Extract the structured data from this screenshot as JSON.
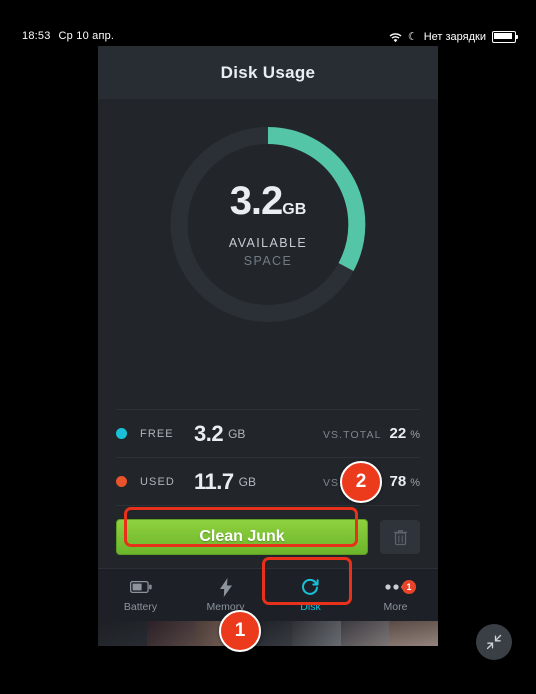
{
  "statusbar": {
    "time": "18:53",
    "date": "Ср 10 апр.",
    "wifi_icon": "wifi-icon",
    "moon_icon": "moon-icon",
    "battery_text": "Нет зарядки",
    "battery_icon": "battery-icon"
  },
  "app": {
    "title": "Disk Usage",
    "donut": {
      "value": "3.2",
      "unit": "GB",
      "label_line1": "AVAILABLE",
      "label_line2": "SPACE",
      "arc_color": "#55c5a8",
      "track_color": "#2b3036",
      "free_percent": 22
    },
    "stats": [
      {
        "name": "free",
        "dot_color": "#19c0d8",
        "label": "FREE",
        "value": "3.2",
        "unit": "GB",
        "vs_label": "VS.TOTAL",
        "percent": "22",
        "percent_unit": "%"
      },
      {
        "name": "used",
        "dot_color": "#e8532b",
        "label": "USED",
        "value": "11.7",
        "unit": "GB",
        "vs_label": "VS.TOTAL",
        "percent": "78",
        "percent_unit": "%"
      }
    ],
    "actions": {
      "clean_label": "Clean Junk",
      "trash_icon": "trash-icon"
    },
    "tabs": [
      {
        "id": "battery",
        "label": "Battery",
        "icon": "battery-icon",
        "active": false,
        "badge": ""
      },
      {
        "id": "memory",
        "label": "Memory",
        "icon": "bolt-icon",
        "active": false,
        "badge": ""
      },
      {
        "id": "disk",
        "label": "Disk",
        "icon": "disk-refresh-icon",
        "active": true,
        "badge": ""
      },
      {
        "id": "more",
        "label": "More",
        "icon": "ellipsis-icon",
        "active": false,
        "badge": "1"
      }
    ]
  },
  "annotations": [
    {
      "id": "1",
      "text": "1"
    },
    {
      "id": "2",
      "text": "2"
    }
  ],
  "float_button": {
    "icon": "collapse-arrows-icon"
  },
  "colors": {
    "accent": "#19c0d8",
    "green": "#7ac433",
    "red": "#e8311a",
    "orange": "#e8532b"
  }
}
